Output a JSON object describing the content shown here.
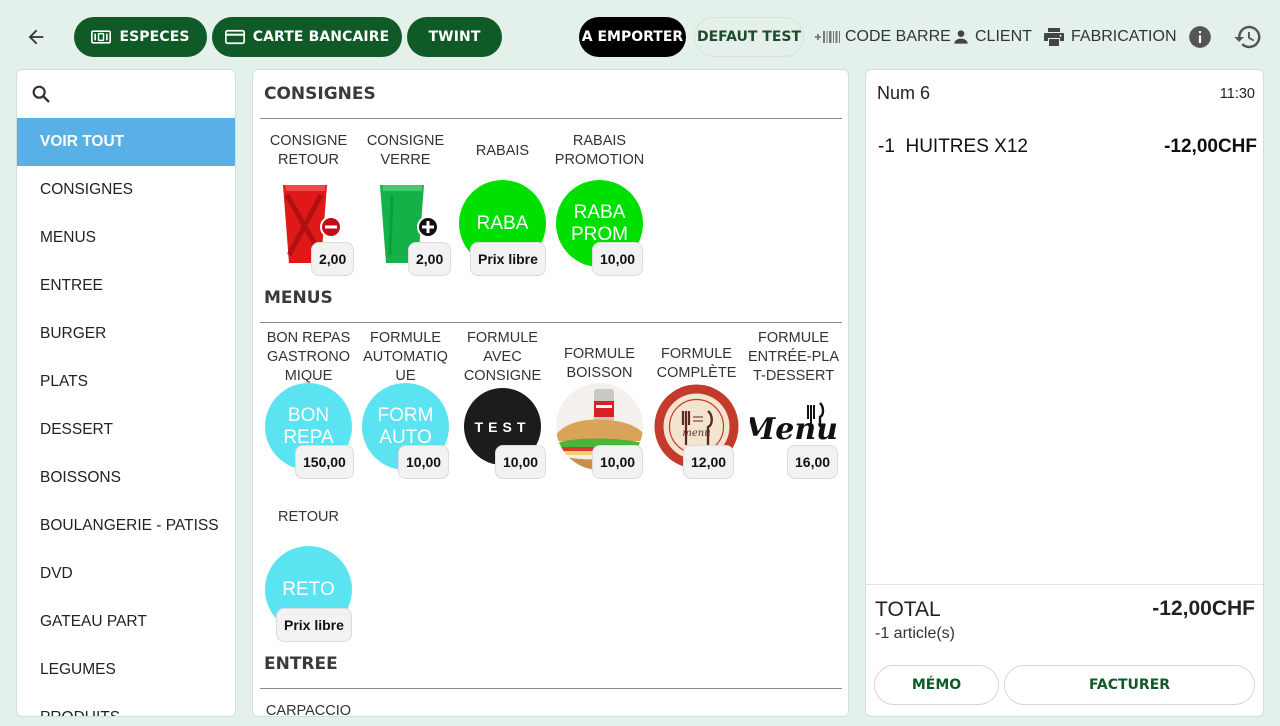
{
  "topbar": {
    "payments": [
      {
        "label": "ESPECES",
        "icon": "cash-icon"
      },
      {
        "label": "CARTE BANCAIRE",
        "icon": "credit-card-icon"
      },
      {
        "label": "TWINT",
        "icon": ""
      }
    ],
    "mode_label": "A EMPORTER",
    "profile_label": "DEFAUT TEST",
    "tools": {
      "barcode": "CODE BARRE",
      "client": "CLIENT",
      "fabrication": "FABRICATION"
    }
  },
  "sidebar": {
    "search_icon": "search-icon",
    "categories": [
      "VOIR TOUT",
      "CONSIGNES",
      "MENUS",
      "ENTREE",
      "BURGER",
      "PLATS",
      "DESSERT",
      "BOISSONS",
      "BOULANGERIE - PATISS",
      "DVD",
      "GATEAU PART",
      "LEGUMES",
      "PRODUITS"
    ],
    "active_index": 0
  },
  "catalog": {
    "sections": [
      {
        "title": "CONSIGNES",
        "products": [
          {
            "name": "CONSIGNE\nRETOUR",
            "price": "2,00",
            "image": "red-cup-minus-icon"
          },
          {
            "name": "CONSIGNE\nVERRE",
            "price": "2,00",
            "image": "green-cup-plus-icon"
          },
          {
            "name": "RABAIS",
            "price": "Prix libre",
            "image": "circle",
            "circle_text": "RABA",
            "color": "#00e000"
          },
          {
            "name": "RABAIS\nPROMOTION",
            "price": "10,00",
            "image": "circle",
            "circle_text": "RABA\nPROM",
            "color": "#00e000"
          }
        ]
      },
      {
        "title": "MENUS",
        "products": [
          {
            "name": "BON REPAS\nGASTRONO\nMIQUE",
            "price": "150,00",
            "image": "circle",
            "circle_text": "BON\nREPA",
            "color": "#5ce3f2"
          },
          {
            "name": "FORMULE\nAUTOMATIQ\nUE",
            "price": "10,00",
            "image": "circle",
            "circle_text": "FORM\nAUTO",
            "color": "#5ce3f2"
          },
          {
            "name": "FORMULE\nAVEC\nCONSIGNE",
            "price": "10,00",
            "image": "test-logo",
            "circle_text": "TEST",
            "color": "#1c1c1c"
          },
          {
            "name": "FORMULE\nBOISSON",
            "price": "10,00",
            "image": "sandwich-drink-photo"
          },
          {
            "name": "FORMULE\nCOMPLÈTE",
            "price": "12,00",
            "image": "menu-plate-icon",
            "circle_text": "menu"
          },
          {
            "name": "FORMULE\nENTRÉE-PLA\nT-DESSERT",
            "price": "16,00",
            "image": "menu-script-logo",
            "circle_text": "Menu"
          },
          {
            "name": "RETOUR",
            "price": "Prix libre",
            "image": "circle",
            "circle_text": "RETO",
            "color": "#5ce3f2"
          }
        ]
      },
      {
        "title": "ENTREE",
        "products": [
          {
            "name": "CARPACCIO",
            "price": "",
            "image": ""
          }
        ]
      }
    ]
  },
  "ticket": {
    "number": "Num 6",
    "time": "11:30",
    "lines": [
      {
        "qty": "-1",
        "name": "HUITRES X12",
        "amount": "-12,00CHF"
      }
    ],
    "total_label": "TOTAL",
    "total_value": "-12,00CHF",
    "count_label": "-1 article(s)",
    "memo_label": "MÉMO",
    "invoice_label": "FACTURER"
  }
}
